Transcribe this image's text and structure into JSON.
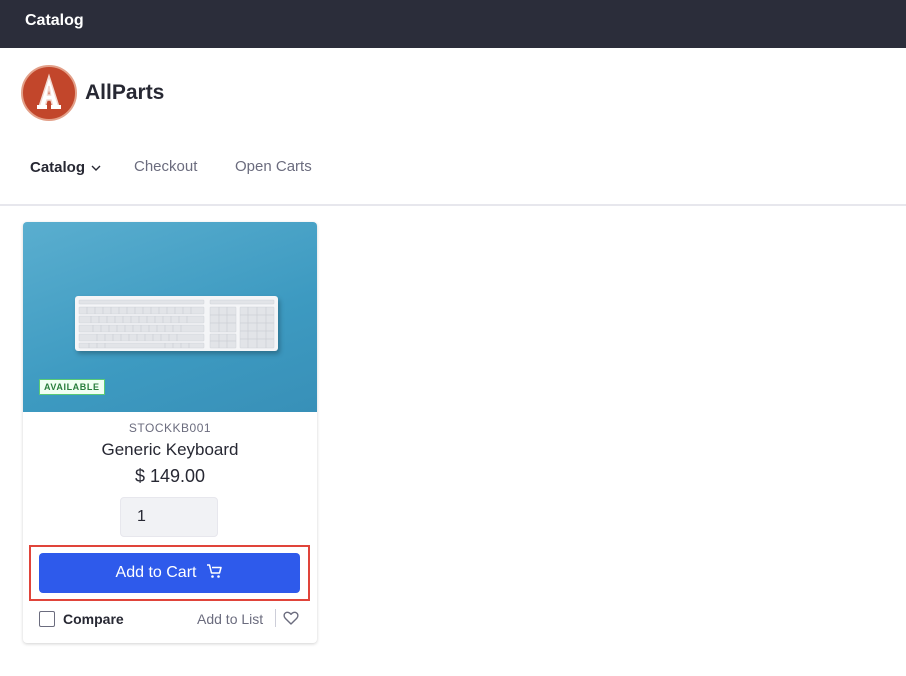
{
  "topbar": {
    "title": "Catalog"
  },
  "brand": {
    "logo_letter": "A",
    "name": "AllParts"
  },
  "nav": {
    "items": [
      {
        "label": "Catalog",
        "active": true,
        "icon": "chevron-down-icon"
      },
      {
        "label": "Checkout",
        "active": false
      },
      {
        "label": "Open Carts",
        "active": false
      }
    ]
  },
  "product": {
    "availability": "AVAILABLE",
    "sku": "STOCKKB001",
    "name": "Generic Keyboard",
    "price": "$ 149.00",
    "quantity": "1",
    "add_to_cart_label": "Add to Cart",
    "add_to_cart_icon": "shopping-cart-icon",
    "compare_label": "Compare",
    "compare_checked": false,
    "add_to_list_label": "Add to List",
    "wishlist_icon": "heart-icon"
  },
  "colors": {
    "topbar": "#2b2d3a",
    "primary_button": "#2e5aeb",
    "highlight_border": "#e0443a",
    "badge_text": "#287d3c",
    "logo": "#c2462b",
    "image_background": "#4aa3c9"
  }
}
